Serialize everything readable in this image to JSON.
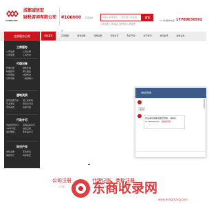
{
  "colors": {
    "brand_red": "#c8161e",
    "sidebar_bg": "#2a2a2a",
    "chat_header": "#3d5b8a",
    "watermark_red": "#d92a2a"
  },
  "header": {
    "logo_sub": "CHENGXIN",
    "company_name_line1": "成都诚信宏",
    "company_name_line2": "财税咨询有限公司",
    "promo_amount": "¥100000",
    "promo_line1": "可获得补贴",
    "promo_line2": "服务价格就是这么透明",
    "search_placeholder": "请输入关键词  如：公司注册 公司注销",
    "search_button": "搜索",
    "hot_links": "公司注册  公司注销  工商代办  公司变更",
    "phone_label": "24小时服务电话：",
    "phone_number": "17780630592"
  },
  "nav": {
    "all_services": "全部服务分类",
    "items": [
      "网站首页",
      "工商服务",
      "财税记账",
      "建筑资质",
      "行政许可",
      "知识产权",
      "关于我们",
      "新闻资讯",
      "最新业务"
    ]
  },
  "sidebar": {
    "group1_title": "工商服务",
    "group1_links": [
      "公司注册",
      "公司注销",
      "公司变更",
      "工商代办"
    ],
    "group2_title": "代理记账",
    "group2_links": [
      "代理记账",
      "税务筹划",
      "财税顾问",
      "审计报告",
      "公司年报",
      "社保代办",
      "汇算清缴",
      "一般纳税人"
    ],
    "group3_title": "建筑资质",
    "group3_links": [
      "建筑资质代办",
      "施工总承包",
      "专业承包",
      "安全许可证",
      "劳务资质",
      "资质升级"
    ],
    "group4_title": "行政许可",
    "group4_links": [
      "食品经营许可",
      "道路运输许可",
      "ICP许可证",
      "进出口权",
      "医疗器械",
      "危化品许可"
    ],
    "group5_title": "知识产权",
    "group5_links": [
      "商标注册",
      "专利申请",
      "版权登记",
      "商标变更"
    ]
  },
  "chat": {
    "title": "诚信宏客服",
    "hello": "您好",
    "message_prefix": "欢迎来到成都诚信宏财税，请联系：",
    "message_phone": "17780630592",
    "message_suffix": "（微信同号）"
  },
  "services": [
    {
      "title": "公司注册",
      "sub": "1元起"
    },
    {
      "title": "代理记账",
      "sub": "200元/月"
    },
    {
      "title": "商标注册",
      "sub": "300元起"
    }
  ],
  "watermark": {
    "text": "东商收录网",
    "sub": "www.dongshang.com"
  }
}
